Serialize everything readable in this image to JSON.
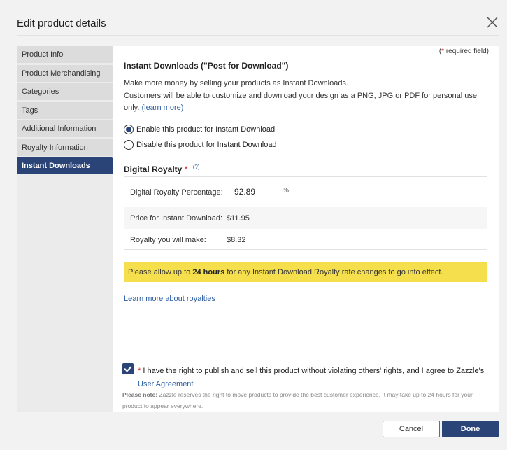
{
  "dialog": {
    "title": "Edit product details"
  },
  "sidebar": {
    "items": [
      {
        "label": "Product Info"
      },
      {
        "label": "Product Merchandising"
      },
      {
        "label": "Categories"
      },
      {
        "label": "Tags"
      },
      {
        "label": "Additional Information"
      },
      {
        "label": "Royalty Information"
      },
      {
        "label": "Instant Downloads",
        "active": true
      }
    ]
  },
  "content": {
    "required_star": "*",
    "required_text": "required field)",
    "required_open": "(",
    "section_title": "Instant Downloads (\"Post for Download\")",
    "desc_line1": "Make more money by selling your products as Instant Downloads.",
    "desc_line2": "Customers will be able to customize and download your design as a PNG, JPG or PDF for personal use only.",
    "learn_more_link": "(learn more)",
    "radio_enable": "Enable this product for Instant Download",
    "radio_disable": "Disable this product for Instant Download",
    "royalty_title": "Digital Royalty",
    "help_icon": "(?)",
    "pct_label": "Digital Royalty Percentage:",
    "pct_value": "92.89",
    "pct_sign": "%",
    "price_label": "Price for Instant Download:",
    "price_value": "$11.95",
    "royalty_label": "Royalty you will make:",
    "royalty_value": "$8.32",
    "notice_pre": "Please allow up to",
    "notice_bold": "24 hours",
    "notice_post": "for any Instant Download Royalty rate changes to go into effect.",
    "learn_royalties": "Learn more about royalties",
    "agree_text": "I have the right to publish and sell this product without violating others' rights, and I agree to Zazzle's",
    "agree_link": "User Agreement",
    "note_label": "Please note:",
    "note_text": "Zazzle reserves the right to move products to provide the best customer experience. It may take up to 24 hours for your product to appear everywhere."
  },
  "buttons": {
    "cancel": "Cancel",
    "done": "Done"
  },
  "colors": {
    "accent": "#2a4478",
    "notice": "#f5df4d",
    "link": "#2c5fa3",
    "required": "#d21d1d"
  }
}
